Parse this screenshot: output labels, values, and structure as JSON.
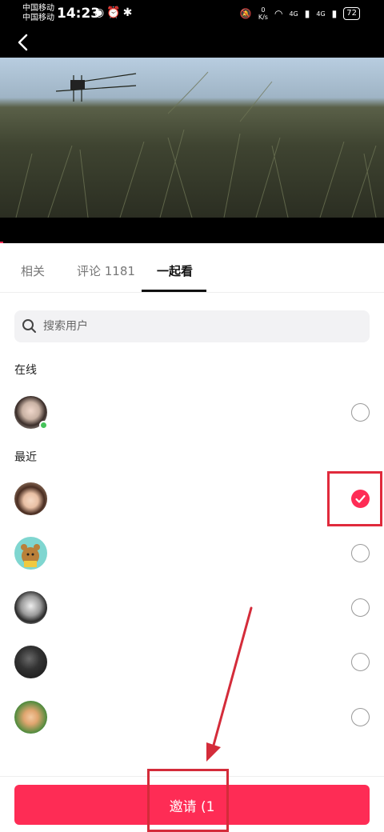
{
  "status_bar": {
    "carrier_1": "中国移动",
    "carrier_2": "中国移动",
    "time": "14:23",
    "net_speed_value": "0",
    "net_speed_unit": "K/s",
    "signal_1": "4G",
    "signal_2": "4G",
    "battery": "72"
  },
  "tabs": [
    {
      "label": "相关",
      "active": false
    },
    {
      "label": "评论 1181",
      "active": false
    },
    {
      "label": "一起看",
      "active": true
    }
  ],
  "search": {
    "placeholder": "搜索用户",
    "value": ""
  },
  "sections": {
    "online": "在线",
    "recent": "最近"
  },
  "online_users": [
    {
      "avatar": "avatar-girl-light",
      "online": true,
      "selected": false
    }
  ],
  "recent_users": [
    {
      "avatar": "avatar-girl-smiling",
      "selected": true
    },
    {
      "avatar": "avatar-cartoon-bear",
      "selected": false
    },
    {
      "avatar": "avatar-person-bw",
      "selected": false
    },
    {
      "avatar": "avatar-dark-photo",
      "selected": false
    },
    {
      "avatar": "avatar-sunglasses",
      "selected": false
    }
  ],
  "invite_button": {
    "label": "邀请 (1"
  },
  "colors": {
    "accent": "#fe2c55",
    "annotation": "#e02a3c",
    "online": "#45c35a"
  }
}
